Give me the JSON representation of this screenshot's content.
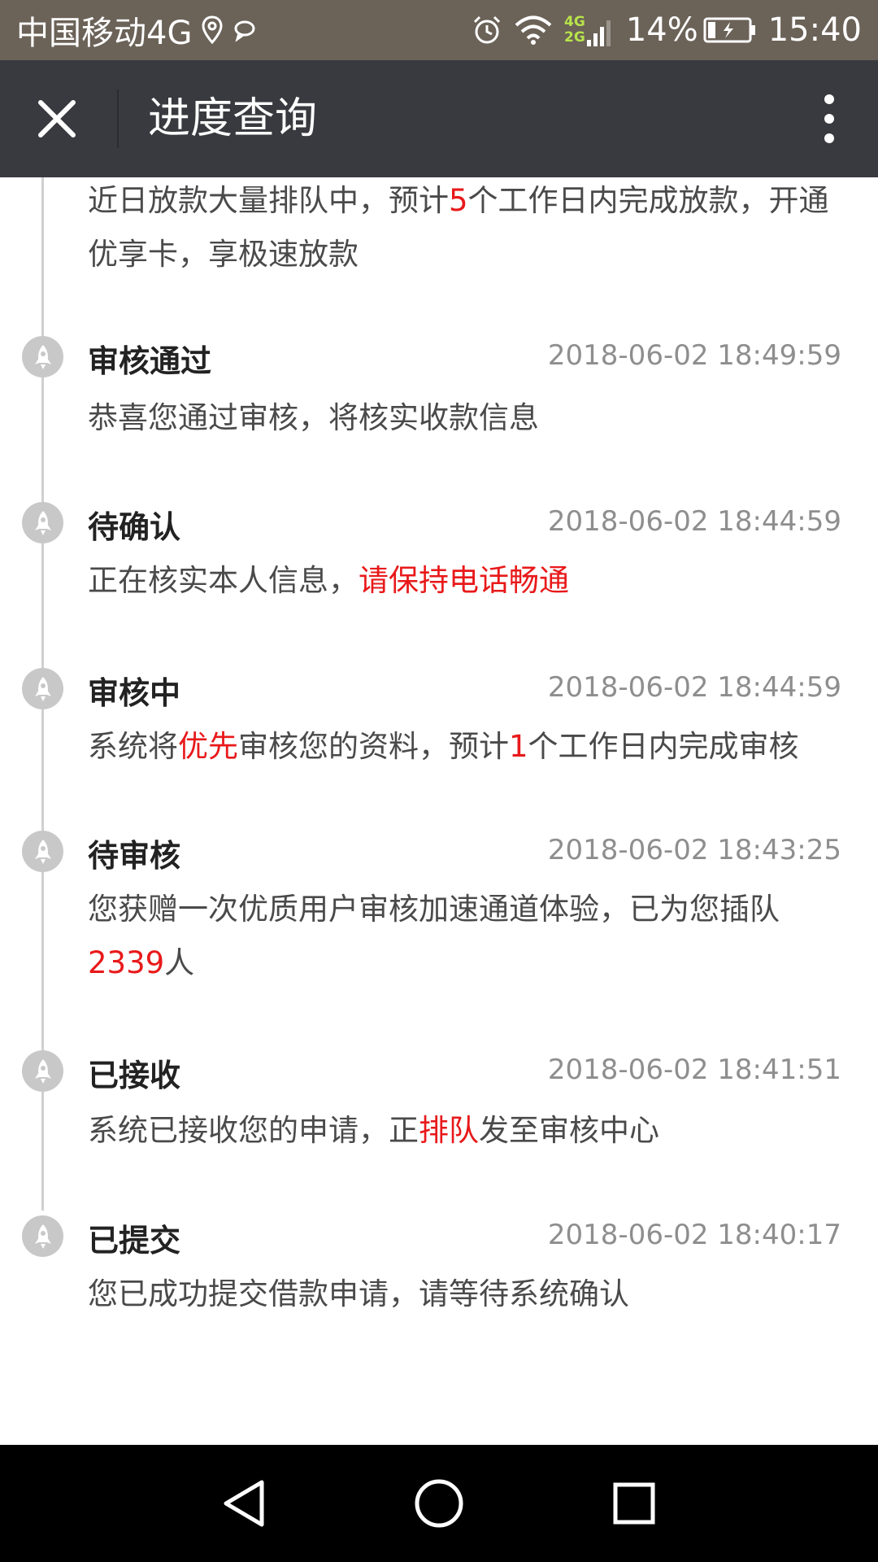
{
  "status_bar": {
    "carrier": "中国移动4G",
    "net_4g": "4G",
    "net_2g": "2G",
    "battery": "14%",
    "time": "15:40"
  },
  "header": {
    "title": "进度查询"
  },
  "timeline": {
    "partial": {
      "desc_a": "近日放款大量排队中，预计",
      "desc_num": "5",
      "desc_b": "个工作日内完成放款，开通优享卡，享极速放款"
    },
    "entries": [
      {
        "title": "审核通过",
        "time": "2018-06-02 18:49:59",
        "desc": "恭喜您通过审核，将核实收款信息"
      },
      {
        "title": "待确认",
        "time": "2018-06-02 18:44:59",
        "desc_a": "正在核实本人信息，",
        "desc_red": "请保持电话畅通"
      },
      {
        "title": "审核中",
        "time": "2018-06-02 18:44:59",
        "desc_a": "系统将",
        "desc_red1": "优先",
        "desc_b": "审核您的资料，预计",
        "desc_red2": "1",
        "desc_c": "个工作日内完成审核"
      },
      {
        "title": "待审核",
        "time": "2018-06-02 18:43:25",
        "desc_a": "您获赠一次优质用户审核加速通道体验，已为您插队",
        "desc_red": "2339",
        "desc_b": "人"
      },
      {
        "title": "已接收",
        "time": "2018-06-02 18:41:51",
        "desc_a": "系统已接收您的申请，正",
        "desc_red": "排队",
        "desc_b": "发至审核中心"
      },
      {
        "title": "已提交",
        "time": "2018-06-02 18:40:17",
        "desc": "您已成功提交借款申请，请等待系统确认"
      }
    ]
  },
  "colors": {
    "status_bar": "#6b6258",
    "title_bar": "#393a3f",
    "highlight": "#e8191a",
    "timeline": "#cfcfcf"
  },
  "icons": {
    "close": "close-icon",
    "more": "more-vertical-icon",
    "dot": "rocket-icon",
    "back": "back-icon",
    "home": "home-icon",
    "recents": "recents-icon"
  }
}
